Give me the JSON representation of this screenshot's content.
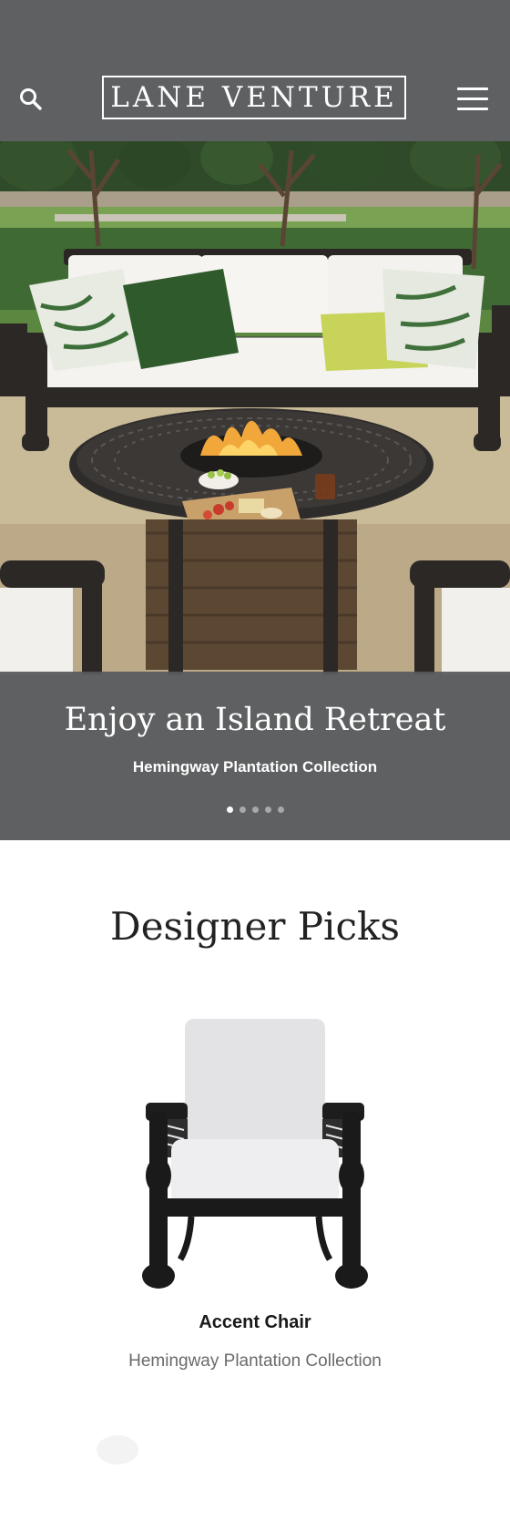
{
  "header": {
    "logo": "LANE VENTURE",
    "search_icon": "search-icon",
    "menu_icon": "hamburger-menu-icon",
    "background": "#5e6062"
  },
  "hero": {
    "title": "Enjoy an Island Retreat",
    "subtitle": "Hemingway Plantation Collection",
    "slide_count": 5,
    "active_slide": 1
  },
  "designer_picks": {
    "title": "Designer Picks",
    "products": [
      {
        "name": "Accent Chair",
        "collection": "Hemingway Plantation Collection"
      }
    ]
  }
}
